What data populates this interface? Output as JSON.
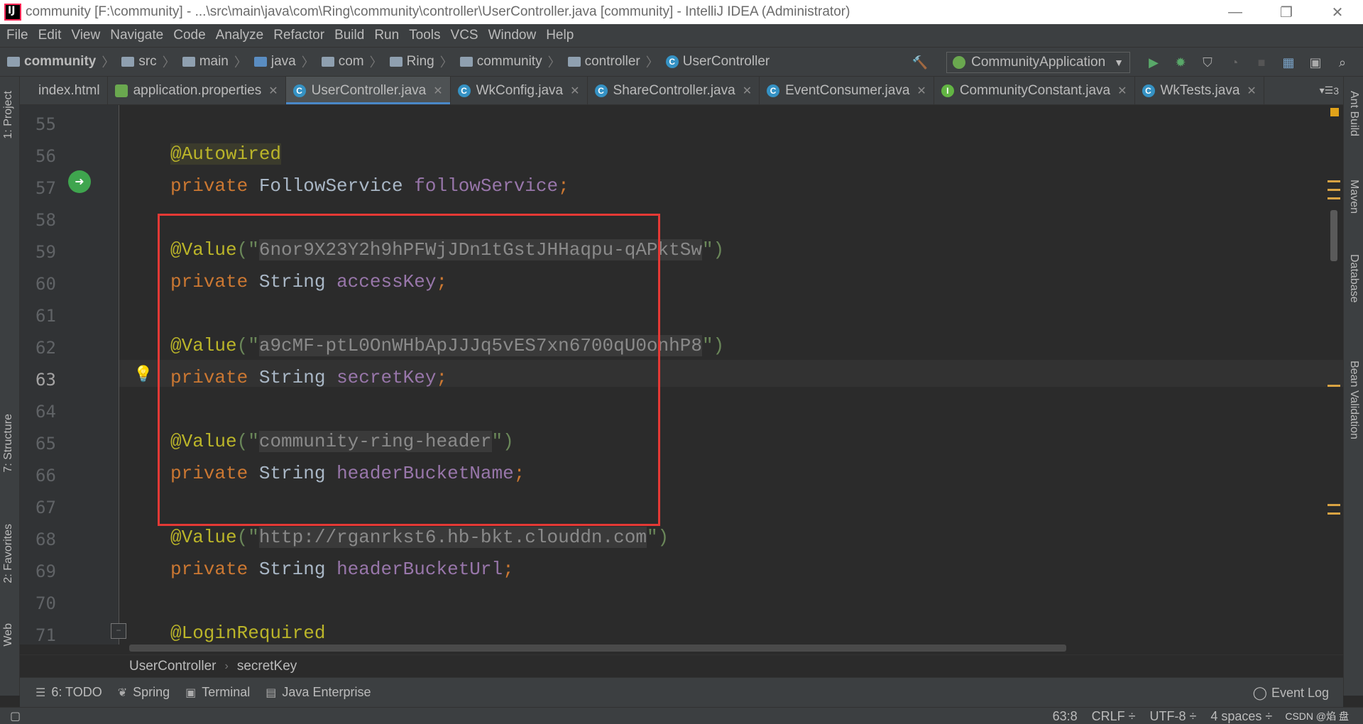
{
  "window": {
    "title": "community [F:\\community] - ...\\src\\main\\java\\com\\Ring\\community\\controller\\UserController.java [community] - IntelliJ IDEA (Administrator)",
    "controls": [
      "—",
      "❐",
      "✕"
    ]
  },
  "menu": [
    "File",
    "Edit",
    "View",
    "Navigate",
    "Code",
    "Analyze",
    "Refactor",
    "Build",
    "Run",
    "Tools",
    "VCS",
    "Window",
    "Help"
  ],
  "breadcrumbs": [
    "community",
    "src",
    "main",
    "java",
    "com",
    "Ring",
    "community",
    "controller",
    "UserController"
  ],
  "run_config": "CommunityApplication",
  "tabs": [
    {
      "label": "index.html",
      "icon": "html-icon",
      "active": false
    },
    {
      "label": "application.properties",
      "icon": "properties-icon",
      "active": false
    },
    {
      "label": "UserController.java",
      "icon": "class-icon",
      "active": true
    },
    {
      "label": "WkConfig.java",
      "icon": "class-icon",
      "active": false
    },
    {
      "label": "ShareController.java",
      "icon": "class-icon",
      "active": false
    },
    {
      "label": "EventConsumer.java",
      "icon": "class-icon",
      "active": false
    },
    {
      "label": "CommunityConstant.java",
      "icon": "interface-icon",
      "active": false
    },
    {
      "label": "WkTests.java",
      "icon": "class-icon",
      "active": false
    }
  ],
  "tabs_more": "3",
  "left_tool_tabs": [
    "1: Project",
    "7: Structure",
    "2: Favorites",
    "Web"
  ],
  "right_tool_tabs": [
    "Ant Build",
    "Maven",
    "Database",
    "Bean Validation"
  ],
  "editor": {
    "line_numbers": [
      "55",
      "56",
      "57",
      "58",
      "59",
      "60",
      "61",
      "62",
      "63",
      "64",
      "65",
      "66",
      "67",
      "68",
      "69",
      "70",
      "71"
    ],
    "current_line": "63",
    "code": {
      "autowired": "@Autowired",
      "private": "private",
      "follow_type": "FollowService",
      "follow_field": "followService",
      "semicolon": ";",
      "value_ann": "@Value",
      "open": "(\"",
      "close": "\")",
      "string_type": "String",
      "access_value": "6nor9X23Y2h9hPFWjJDn1tGstJHHaqpu-qAPktSw",
      "access_field": "accessKey",
      "secret_value": "a9cMF-ptL0OnWHbApJJJq5vES7xn6700qU0onhP8",
      "secret_field": "secretKey",
      "bucket_value": "community-ring-header",
      "bucket_field": "headerBucketName",
      "url_value": "http://rganrkst6.hb-bkt.clouddn.com",
      "url_field": "headerBucketUrl",
      "login_required": "@LoginRequired"
    }
  },
  "footer_breadcrumb": [
    "UserController",
    "secretKey"
  ],
  "tool_windows": [
    {
      "label": "6: TODO",
      "icon": "list-icon"
    },
    {
      "label": "Spring",
      "icon": "spring-icon"
    },
    {
      "label": "Terminal",
      "icon": "terminal-icon"
    },
    {
      "label": "Java Enterprise",
      "icon": "enterprise-icon"
    }
  ],
  "event_log": "Event Log",
  "status": {
    "position": "63:8",
    "line_sep": "CRLF ÷",
    "encoding": "UTF-8 ÷",
    "indent": "4 spaces ÷",
    "watermark": "CSDN @焰 盘"
  },
  "colors": {
    "keyword": "#cc7832",
    "annotation": "#bbb529",
    "field": "#9876aa",
    "string": "#6a8759",
    "highlight_box": "#e53935"
  }
}
